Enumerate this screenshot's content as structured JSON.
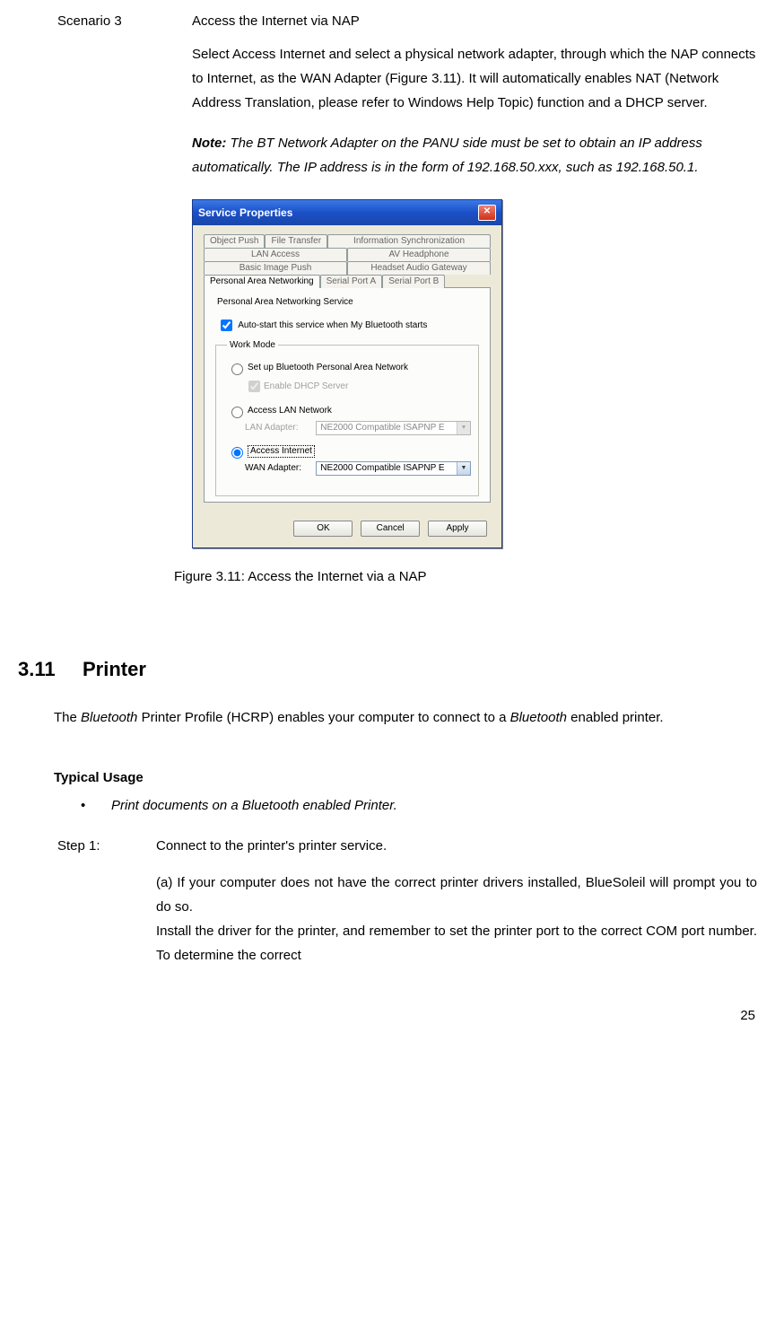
{
  "scenario": {
    "label": "Scenario 3",
    "title": "Access the Internet via NAP",
    "para": "Select Access Internet and select a physical network adapter, through which the NAP connects to Internet, as the WAN Adapter (Figure 3.11). It will automatically enables NAT (Network Address Translation, please refer to Windows Help Topic) function and a DHCP server.",
    "note_label": "Note:",
    "note_text": " The BT Network Adapter on the PANU side must be set to obtain an IP address automatically. The IP address is in the form of 192.168.50.xxx, such as 192.168.50.1."
  },
  "dialog": {
    "title": "Service Properties",
    "tabs_row1": [
      "Object Push",
      "File Transfer",
      "Information Synchronization"
    ],
    "tabs_row2": [
      "LAN Access",
      "AV Headphone"
    ],
    "tabs_row3": [
      "Basic Image Push",
      "Headset Audio Gateway"
    ],
    "tabs_row4": [
      "Personal Area Networking",
      "Serial Port A",
      "Serial Port B"
    ],
    "section_title": "Personal Area Networking Service",
    "autostart": "Auto-start this service when My Bluetooth starts",
    "work_mode": "Work Mode",
    "opt_pan": "Set up Bluetooth Personal Area Network",
    "enable_dhcp": "Enable DHCP Server",
    "opt_lan": "Access LAN Network",
    "lan_adapter_label": "LAN Adapter:",
    "lan_adapter_value": "NE2000 Compatible ISAPNP E",
    "opt_internet": "Access Internet",
    "wan_adapter_label": "WAN Adapter:",
    "wan_adapter_value": "NE2000 Compatible ISAPNP E",
    "ok": "OK",
    "cancel": "Cancel",
    "apply": "Apply"
  },
  "figure_caption": "Figure 3.11: Access the Internet via a NAP",
  "printer": {
    "heading_no": "3.11",
    "heading_txt": "Printer",
    "intro_pre": "The ",
    "intro_it1": "Bluetooth",
    "intro_mid": " Printer Profile (HCRP) enables your computer to connect to a ",
    "intro_it2": "Bluetooth",
    "intro_post": " enabled printer.",
    "typical": "Typical Usage",
    "bullet": "Print documents on a Bluetooth enabled Printer.",
    "step1_label": "Step 1:",
    "step1_text": "Connect to the printer's printer service.",
    "step1_a": "(a) If your computer does not have the correct printer drivers installed, BlueSoleil will prompt you to do so.",
    "step1_a2": "Install the driver for the printer, and remember to set the printer port to the correct COM port number. To determine the correct"
  },
  "page_number": "25"
}
